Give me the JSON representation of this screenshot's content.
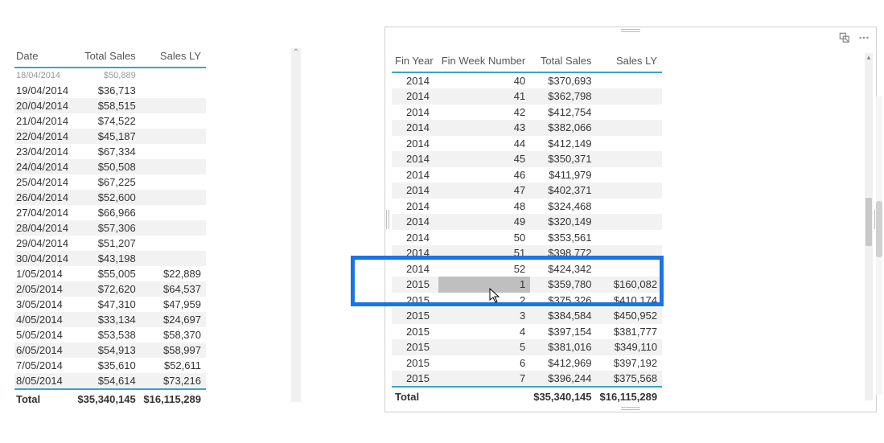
{
  "left": {
    "headers": {
      "date": "Date",
      "sales": "Total Sales",
      "salesLY": "Sales LY"
    },
    "cutRow": {
      "date": "18/04/2014",
      "sales": "$50,889"
    },
    "rows": [
      {
        "date": "19/04/2014",
        "sales": "$36,713",
        "salesLY": ""
      },
      {
        "date": "20/04/2014",
        "sales": "$58,515",
        "salesLY": ""
      },
      {
        "date": "21/04/2014",
        "sales": "$74,522",
        "salesLY": ""
      },
      {
        "date": "22/04/2014",
        "sales": "$45,187",
        "salesLY": ""
      },
      {
        "date": "23/04/2014",
        "sales": "$67,334",
        "salesLY": ""
      },
      {
        "date": "24/04/2014",
        "sales": "$50,508",
        "salesLY": ""
      },
      {
        "date": "25/04/2014",
        "sales": "$67,225",
        "salesLY": ""
      },
      {
        "date": "26/04/2014",
        "sales": "$52,600",
        "salesLY": ""
      },
      {
        "date": "27/04/2014",
        "sales": "$66,966",
        "salesLY": ""
      },
      {
        "date": "28/04/2014",
        "sales": "$57,306",
        "salesLY": ""
      },
      {
        "date": "29/04/2014",
        "sales": "$51,207",
        "salesLY": ""
      },
      {
        "date": "30/04/2014",
        "sales": "$43,198",
        "salesLY": ""
      },
      {
        "date": "1/05/2014",
        "sales": "$55,005",
        "salesLY": "$22,889"
      },
      {
        "date": "2/05/2014",
        "sales": "$72,620",
        "salesLY": "$64,537"
      },
      {
        "date": "3/05/2014",
        "sales": "$47,310",
        "salesLY": "$47,959"
      },
      {
        "date": "4/05/2014",
        "sales": "$33,134",
        "salesLY": "$24,697"
      },
      {
        "date": "5/05/2014",
        "sales": "$53,538",
        "salesLY": "$58,370"
      },
      {
        "date": "6/05/2014",
        "sales": "$54,913",
        "salesLY": "$58,997"
      },
      {
        "date": "7/05/2014",
        "sales": "$35,610",
        "salesLY": "$52,611"
      },
      {
        "date": "8/05/2014",
        "sales": "$54,614",
        "salesLY": "$73,216"
      }
    ],
    "total": {
      "label": "Total",
      "sales": "$35,340,145",
      "salesLY": "$16,115,289"
    }
  },
  "right": {
    "headers": {
      "year": "Fin Year",
      "week": "Fin Week Number",
      "sales": "Total Sales",
      "salesLY": "Sales LY"
    },
    "rows": [
      {
        "year": "2014",
        "week": "40",
        "sales": "$370,693",
        "salesLY": ""
      },
      {
        "year": "2014",
        "week": "41",
        "sales": "$362,798",
        "salesLY": ""
      },
      {
        "year": "2014",
        "week": "42",
        "sales": "$412,754",
        "salesLY": ""
      },
      {
        "year": "2014",
        "week": "43",
        "sales": "$382,066",
        "salesLY": ""
      },
      {
        "year": "2014",
        "week": "44",
        "sales": "$412,149",
        "salesLY": ""
      },
      {
        "year": "2014",
        "week": "45",
        "sales": "$350,371",
        "salesLY": ""
      },
      {
        "year": "2014",
        "week": "46",
        "sales": "$411,979",
        "salesLY": ""
      },
      {
        "year": "2014",
        "week": "47",
        "sales": "$402,371",
        "salesLY": ""
      },
      {
        "year": "2014",
        "week": "48",
        "sales": "$324,468",
        "salesLY": ""
      },
      {
        "year": "2014",
        "week": "49",
        "sales": "$320,149",
        "salesLY": ""
      },
      {
        "year": "2014",
        "week": "50",
        "sales": "$353,561",
        "salesLY": ""
      },
      {
        "year": "2014",
        "week": "51",
        "sales": "$398,772",
        "salesLY": ""
      },
      {
        "year": "2014",
        "week": "52",
        "sales": "$424,342",
        "salesLY": ""
      },
      {
        "year": "2015",
        "week": "1",
        "sales": "$359,780",
        "salesLY": "$160,082",
        "selected": true
      },
      {
        "year": "2015",
        "week": "2",
        "sales": "$375,326",
        "salesLY": "$410,174"
      },
      {
        "year": "2015",
        "week": "3",
        "sales": "$384,584",
        "salesLY": "$450,952"
      },
      {
        "year": "2015",
        "week": "4",
        "sales": "$397,154",
        "salesLY": "$381,777"
      },
      {
        "year": "2015",
        "week": "5",
        "sales": "$381,016",
        "salesLY": "$349,110"
      },
      {
        "year": "2015",
        "week": "6",
        "sales": "$412,969",
        "salesLY": "$397,192"
      },
      {
        "year": "2015",
        "week": "7",
        "sales": "$396,244",
        "salesLY": "$375,568"
      }
    ],
    "total": {
      "label": "Total",
      "sales": "$35,340,145",
      "salesLY": "$16,115,289"
    }
  }
}
